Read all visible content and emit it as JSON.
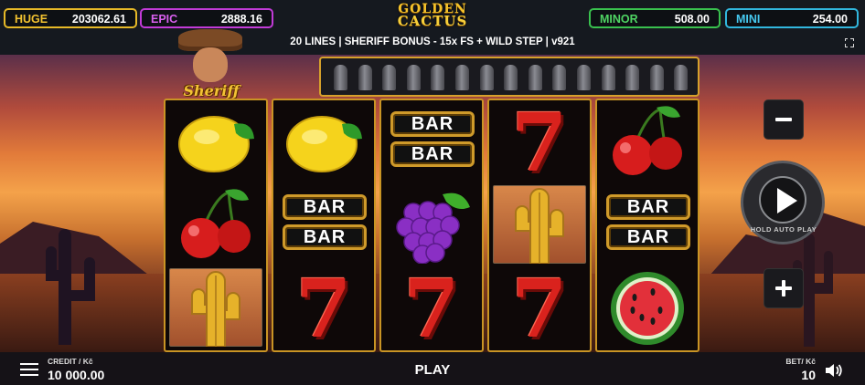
{
  "jackpots": {
    "huge": {
      "label": "HUGE",
      "value": "203062.61"
    },
    "epic": {
      "label": "EPIC",
      "value": "2888.16"
    },
    "minor": {
      "label": "MINOR",
      "value": "508.00"
    },
    "mini": {
      "label": "MINI",
      "value": "254.00"
    }
  },
  "logo": {
    "line1": "GOLDEN",
    "line2": "CACTUS"
  },
  "info_line": "20 LINES  | SHERIFF BONUS - 15x FS + WILD STEP | v921",
  "sheriff": {
    "label": "Sheriff"
  },
  "bullets": {
    "count": 15
  },
  "reels": [
    [
      "lemon",
      "cherry",
      "cactus"
    ],
    [
      "lemon",
      "double-bar",
      "seven"
    ],
    [
      "double-bar",
      "grapes",
      "seven"
    ],
    [
      "seven",
      "cactus",
      "seven"
    ],
    [
      "cherry",
      "double-bar",
      "watermelon"
    ]
  ],
  "symbols": {
    "bar_text": "BAR",
    "seven_text": "7"
  },
  "controls": {
    "bet_down_label": "−",
    "bet_up_label": "+",
    "autoplay_label": "HOLD AUTO PLAY"
  },
  "bottom": {
    "credit_label": "CREDIT / Kč",
    "credit_value": "10 000.00",
    "play_label": "PLAY",
    "bet_label": "BET/ Kč",
    "bet_value": "10"
  },
  "colors": {
    "huge": "#e6b927",
    "epic": "#c23bd8",
    "minor": "#39c14e",
    "mini": "#31b7de",
    "reel_frame": "#c99424"
  }
}
